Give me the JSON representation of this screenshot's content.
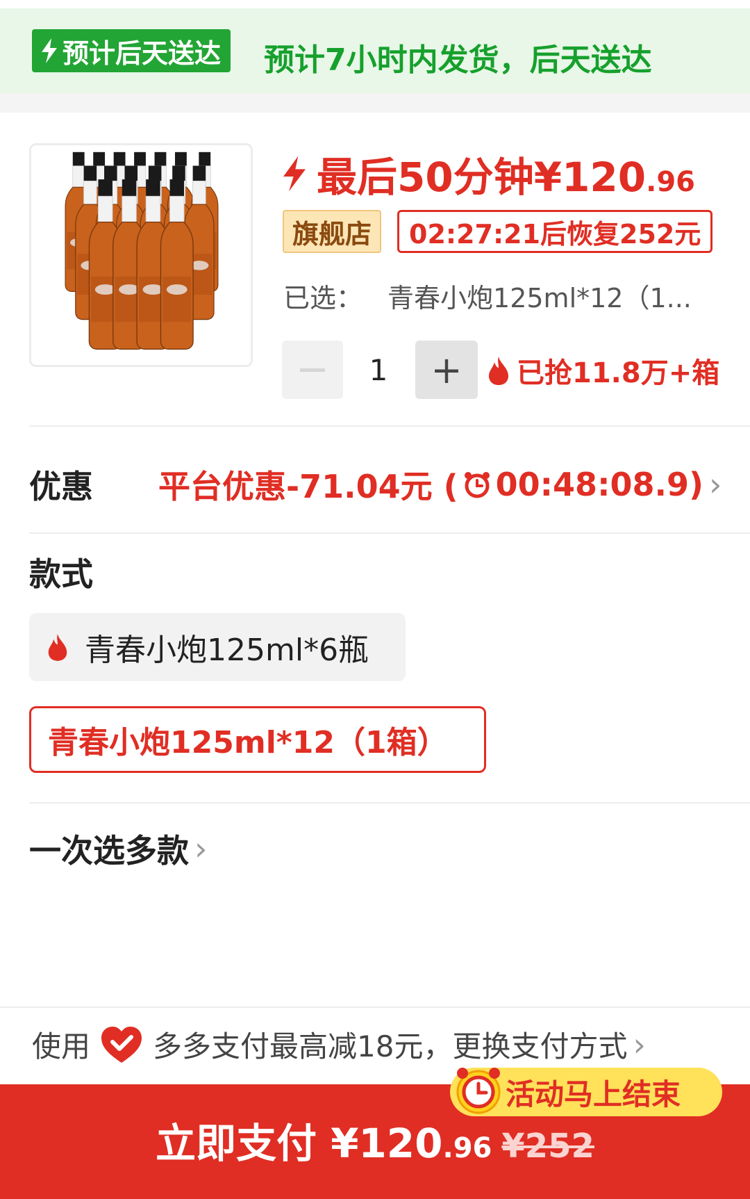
{
  "delivery": {
    "badge": "预计后天送达",
    "text": "预计7小时内发货，后天送达",
    "color": "#22a534"
  },
  "product": {
    "image_alt": "product-bottles",
    "promo_label": "最后50分钟¥120",
    "promo_decimal": ".96",
    "store_badge": "旗舰店",
    "countdown_restore": "02:27:21后恢复252元",
    "selected_label": "已选：",
    "selected_value": "青春小炮125ml*12（1...",
    "quantity": "1",
    "minus_icon": "minus-icon",
    "plus_symbol": "+",
    "sold": "已抢11.8万+箱"
  },
  "discount": {
    "label": "优惠",
    "prefix": "平台优惠-71.04元 (",
    "timer": "00:48:08.9)",
    "chevron": "›"
  },
  "style": {
    "label": "款式",
    "options": [
      {
        "label": "青春小炮125ml*6瓶",
        "hot": true,
        "selected": false
      },
      {
        "label": "青春小炮125ml*12（1箱）",
        "hot": false,
        "selected": true
      }
    ]
  },
  "multi": {
    "label": "一次选多款",
    "chevron": "›"
  },
  "payment": {
    "use_label": "使用",
    "text": "多多支付最高减18元，更换支付方式",
    "chevron": "›"
  },
  "bottom": {
    "ending_text": "活动马上结束",
    "pay_label": "立即支付",
    "price": "¥120",
    "price_decimal": ".96",
    "original_price": "¥252"
  },
  "colors": {
    "accent_red": "#e02e24",
    "green": "#16a02c",
    "yellow": "#ffe15a"
  }
}
